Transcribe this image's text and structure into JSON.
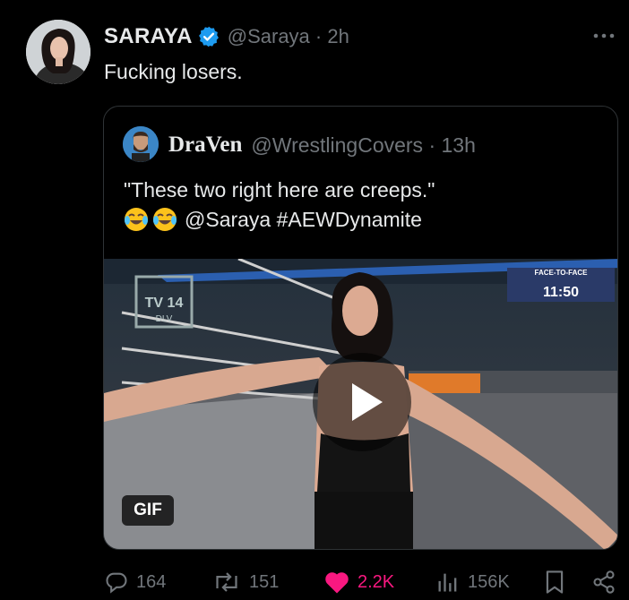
{
  "tweet": {
    "author_name": "SARAYA",
    "author_handle": "@Saraya · 2h",
    "text": "Fucking losers."
  },
  "quote": {
    "author_name": "DraVen",
    "author_handle": "@WrestlingCovers · 13h",
    "text_line1": "\"These two right here are creeps.\"",
    "text_line2": "@Saraya #AEWDynamite",
    "media_badge": "GIF",
    "overlay": {
      "rating": "TV 14",
      "rating_sub": "DLV",
      "face_to_face_label": "FACE-TO-FACE",
      "clock": "11:50"
    }
  },
  "actions": {
    "replies": "164",
    "reposts": "151",
    "likes": "2.2K",
    "views": "156K"
  },
  "colors": {
    "background": "#000000",
    "text": "#e7e9ea",
    "secondary": "#71767b",
    "verified": "#1d9bf0",
    "like": "#f91880",
    "border": "#2f3336"
  },
  "icons": [
    "verified-badge-icon",
    "more-icon",
    "play-icon",
    "reply-icon",
    "repost-icon",
    "heart-icon",
    "views-icon",
    "bookmark-icon",
    "share-icon",
    "emoji-joy-icon"
  ]
}
